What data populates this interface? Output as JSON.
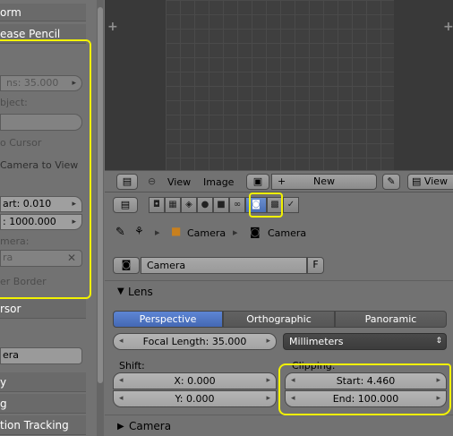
{
  "left_panel": {
    "transform_header": "orm",
    "grease_pencil_header": "ease Pencil",
    "focal_field": "ns: 35.000",
    "object_label": "bject:",
    "to_cursor_label": "o Cursor",
    "camera_to_view_label": "Camera to View",
    "clip_start_field": "art: 0.010",
    "clip_end_field": ": 1000.000",
    "camera_label": "mera:",
    "camera_field": "ra",
    "border_label": "er Border",
    "cursor_header": "rsor",
    "camera_name_field": "era",
    "item_y": "y",
    "item_g": "g",
    "motion_tracking": "tion Tracking"
  },
  "image_header": {
    "view_menu": "View",
    "image_menu": "Image",
    "new_button": "New",
    "view_right": "View"
  },
  "properties": {
    "breadcrumb": [
      "Camera",
      "Camera"
    ],
    "datablock_name": "Camera",
    "fake_user": "F",
    "lens_panel": "Lens",
    "lens_types": [
      "Perspective",
      "Orthographic",
      "Panoramic"
    ],
    "active_lens_type": "Perspective",
    "focal_length": "Focal Length: 35.000",
    "unit": "Millimeters",
    "shift_label": "Shift:",
    "shift_x": "X: 0.000",
    "shift_y": "Y: 0.000",
    "clipping_label": "Clipping:",
    "clip_start": "Start: 4.460",
    "clip_end": "End: 100.000",
    "camera_panel": "Camera"
  },
  "colors": {
    "highlight": "#f2f200",
    "accent_blue": "#5e86d4"
  }
}
